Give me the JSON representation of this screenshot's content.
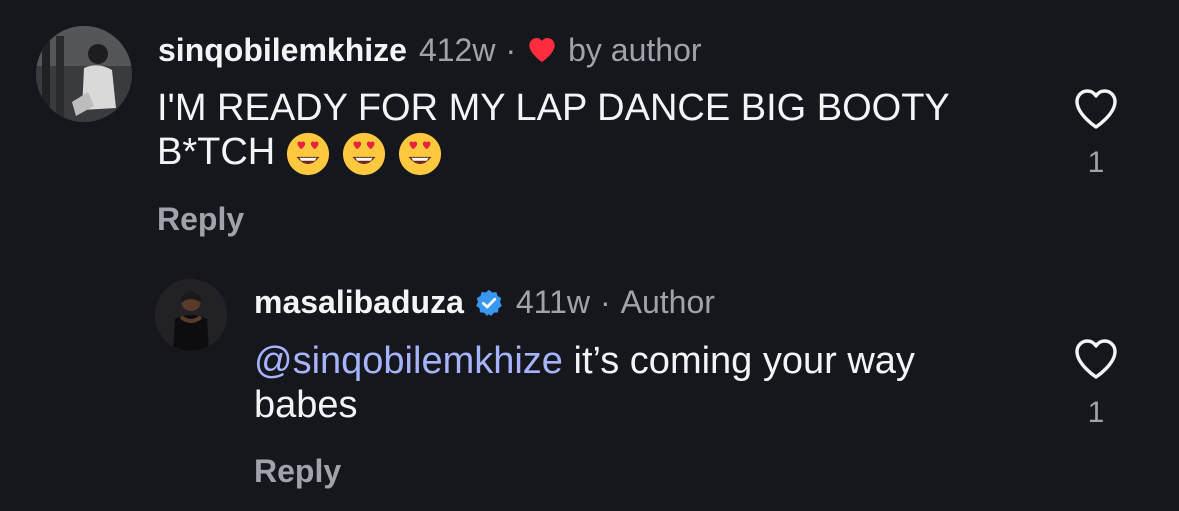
{
  "comments": [
    {
      "username": "sinqobilemkhize",
      "time": "412w",
      "badge_text": "by author",
      "text_line1": "I'M READY FOR MY LAP DANCE BIG BOOTY",
      "text_line2": "B*TCH",
      "emojis": [
        "heart-eyes-emoji",
        "heart-eyes-emoji",
        "heart-eyes-emoji"
      ],
      "reply_label": "Reply",
      "like_count": "1"
    },
    {
      "username": "masalibaduza",
      "time": "411w",
      "author_label": "Author",
      "mention": "@sinqobilemkhize",
      "text_line1_rest": " it’s coming your way",
      "text_line2": "babes",
      "reply_label": "Reply",
      "like_count": "1"
    }
  ],
  "colors": {
    "background": "#15171c",
    "text": "#f3f4f6",
    "muted": "#a0a3ab",
    "mention": "#a6b3ff",
    "like_heart": "#ff2d3d",
    "verified": "#3897f0"
  }
}
